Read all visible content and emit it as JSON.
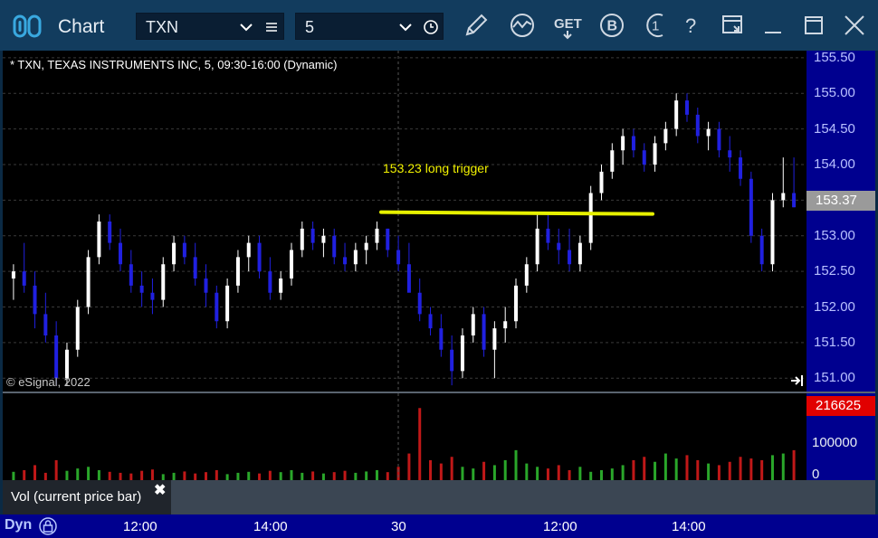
{
  "window": {
    "title": "Chart",
    "symbol_value": "TXN",
    "interval_value": "5"
  },
  "chart": {
    "label": "* TXN, TEXAS INSTRUMENTS INC, 5, 09:30-16:00 (Dynamic)",
    "copyright": "© eSignal, 2022",
    "annotation": "153.23 long trigger",
    "price_ticks": [
      "155.50",
      "155.00",
      "154.50",
      "154.00",
      "153.50",
      "153.00",
      "152.50",
      "152.00",
      "151.50",
      "151.00"
    ],
    "last_price": "153.37",
    "volume_last": "216625",
    "volume_ticks": [
      "100000",
      "0"
    ],
    "indicator_label": "Vol (current price bar)",
    "close_glyph": "✖",
    "dyn_label": "Dyn",
    "time_ticks": [
      "12:00",
      "14:00",
      "30",
      "12:00",
      "14:00"
    ]
  },
  "colors": {
    "up_candle": "#ffffff",
    "down_candle": "#2020e0",
    "annotation_line": "#e6f000",
    "volume_up": "#2aa62a",
    "volume_down": "#c01818"
  },
  "icons": [
    "logo-icon",
    "chevron-down-icon",
    "menu-icon",
    "clock-icon",
    "pencil-icon",
    "study-icon",
    "get-icon",
    "b-icon",
    "t-icon",
    "help-icon",
    "layout-icon",
    "minimize-icon",
    "maximize-icon",
    "close-icon",
    "jump-to-end-icon",
    "lock-icon"
  ],
  "chart_data": {
    "type": "candlestick",
    "symbol": "TXN",
    "ylim": [
      150.8,
      155.6
    ],
    "annotation_level": 153.23,
    "candles": [
      [
        152.4,
        152.6,
        152.1,
        152.5
      ],
      [
        152.5,
        152.9,
        152.2,
        152.3
      ],
      [
        152.3,
        152.5,
        151.7,
        151.9
      ],
      [
        151.9,
        152.2,
        151.5,
        151.6
      ],
      [
        151.6,
        151.8,
        150.9,
        151.0
      ],
      [
        151.0,
        151.5,
        150.9,
        151.4
      ],
      [
        151.4,
        152.1,
        151.3,
        152.0
      ],
      [
        152.0,
        152.8,
        151.9,
        152.7
      ],
      [
        152.7,
        153.3,
        152.6,
        153.2
      ],
      [
        153.2,
        153.3,
        152.8,
        152.9
      ],
      [
        152.9,
        153.1,
        152.5,
        152.6
      ],
      [
        152.6,
        152.8,
        152.2,
        152.3
      ],
      [
        152.3,
        152.5,
        152.0,
        152.2
      ],
      [
        152.2,
        152.4,
        151.9,
        152.1
      ],
      [
        152.1,
        152.7,
        152.0,
        152.6
      ],
      [
        152.6,
        153.0,
        152.5,
        152.9
      ],
      [
        152.9,
        153.0,
        152.6,
        152.7
      ],
      [
        152.7,
        152.9,
        152.3,
        152.4
      ],
      [
        152.4,
        152.6,
        152.0,
        152.2
      ],
      [
        152.2,
        152.3,
        151.7,
        151.8
      ],
      [
        151.8,
        152.4,
        151.7,
        152.3
      ],
      [
        152.3,
        152.8,
        152.2,
        152.7
      ],
      [
        152.7,
        153.0,
        152.5,
        152.9
      ],
      [
        152.9,
        153.0,
        152.4,
        152.5
      ],
      [
        152.5,
        152.7,
        152.1,
        152.2
      ],
      [
        152.2,
        152.5,
        152.1,
        152.4
      ],
      [
        152.4,
        152.9,
        152.3,
        152.8
      ],
      [
        152.8,
        153.2,
        152.7,
        153.1
      ],
      [
        153.1,
        153.2,
        152.8,
        152.9
      ],
      [
        152.9,
        153.1,
        152.7,
        153.0
      ],
      [
        153.0,
        153.1,
        152.6,
        152.7
      ],
      [
        152.7,
        152.9,
        152.5,
        152.6
      ],
      [
        152.6,
        152.9,
        152.5,
        152.8
      ],
      [
        152.8,
        153.0,
        152.6,
        152.9
      ],
      [
        152.9,
        153.2,
        152.8,
        153.1
      ],
      [
        153.1,
        153.1,
        152.7,
        152.8
      ],
      [
        152.8,
        153.0,
        152.5,
        152.6
      ],
      [
        152.6,
        152.9,
        152.4,
        152.2
      ],
      [
        152.2,
        152.4,
        151.8,
        151.9
      ],
      [
        151.9,
        152.0,
        151.6,
        151.7
      ],
      [
        151.7,
        151.9,
        151.3,
        151.4
      ],
      [
        151.4,
        151.6,
        150.9,
        151.1
      ],
      [
        151.1,
        151.7,
        151.0,
        151.6
      ],
      [
        151.6,
        152.0,
        151.5,
        151.9
      ],
      [
        151.9,
        152.0,
        151.3,
        151.4
      ],
      [
        151.4,
        151.8,
        151.0,
        151.7
      ],
      [
        151.7,
        152.0,
        151.5,
        151.8
      ],
      [
        151.8,
        152.4,
        151.7,
        152.3
      ],
      [
        152.3,
        152.7,
        152.2,
        152.6
      ],
      [
        152.6,
        153.3,
        152.5,
        153.1
      ],
      [
        153.1,
        153.3,
        152.8,
        152.9
      ],
      [
        152.9,
        153.1,
        152.6,
        152.8
      ],
      [
        152.8,
        153.1,
        152.5,
        152.6
      ],
      [
        152.6,
        153.0,
        152.5,
        152.9
      ],
      [
        152.9,
        153.7,
        152.8,
        153.6
      ],
      [
        153.6,
        154.0,
        153.5,
        153.9
      ],
      [
        153.9,
        154.3,
        153.8,
        154.2
      ],
      [
        154.2,
        154.5,
        154.0,
        154.4
      ],
      [
        154.4,
        154.5,
        154.1,
        154.2
      ],
      [
        154.2,
        154.3,
        153.9,
        154.0
      ],
      [
        154.0,
        154.4,
        153.9,
        154.3
      ],
      [
        154.3,
        154.6,
        154.2,
        154.5
      ],
      [
        154.5,
        155.0,
        154.4,
        154.9
      ],
      [
        154.9,
        155.0,
        154.6,
        154.7
      ],
      [
        154.7,
        154.8,
        154.3,
        154.4
      ],
      [
        154.4,
        154.6,
        154.2,
        154.5
      ],
      [
        154.5,
        154.6,
        154.1,
        154.2
      ],
      [
        154.2,
        154.4,
        153.9,
        154.1
      ],
      [
        154.1,
        154.2,
        153.7,
        153.8
      ],
      [
        153.8,
        153.9,
        152.9,
        153.0
      ],
      [
        153.0,
        153.1,
        152.5,
        152.6
      ],
      [
        152.6,
        153.6,
        152.5,
        153.5
      ],
      [
        153.5,
        154.1,
        153.4,
        153.6
      ],
      [
        153.6,
        154.1,
        153.4,
        153.4
      ]
    ],
    "volume": {
      "annotated_last": 216625,
      "ylim": [
        0,
        250000
      ],
      "values": [
        25000,
        30000,
        45000,
        22000,
        60000,
        28000,
        35000,
        40000,
        30000,
        25000,
        22000,
        20000,
        28000,
        32000,
        18000,
        22000,
        26000,
        20000,
        24000,
        30000,
        18000,
        22000,
        25000,
        20000,
        28000,
        24000,
        30000,
        22000,
        26000,
        20000,
        24000,
        28000,
        22000,
        26000,
        30000,
        24000,
        40000,
        80000,
        216625,
        60000,
        50000,
        70000,
        40000,
        35000,
        55000,
        45000,
        60000,
        90000,
        50000,
        40000,
        35000,
        45000,
        30000,
        40000,
        25000,
        30000,
        35000,
        45000,
        60000,
        70000,
        55000,
        80000,
        65000,
        75000,
        60000,
        50000,
        45000,
        55000,
        70000,
        65000,
        60000,
        75000,
        80000,
        90000
      ]
    }
  }
}
